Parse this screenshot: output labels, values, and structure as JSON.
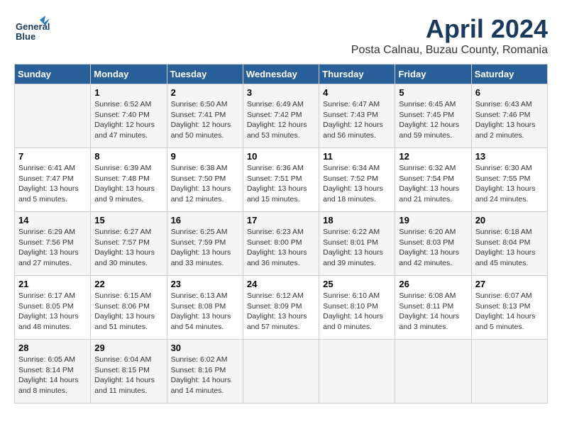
{
  "logo": {
    "line1": "General",
    "line2": "Blue"
  },
  "title": "April 2024",
  "subtitle": "Posta Calnau, Buzau County, Romania",
  "headers": [
    "Sunday",
    "Monday",
    "Tuesday",
    "Wednesday",
    "Thursday",
    "Friday",
    "Saturday"
  ],
  "weeks": [
    [
      {
        "day": "",
        "info": ""
      },
      {
        "day": "1",
        "info": "Sunrise: 6:52 AM\nSunset: 7:40 PM\nDaylight: 12 hours\nand 47 minutes."
      },
      {
        "day": "2",
        "info": "Sunrise: 6:50 AM\nSunset: 7:41 PM\nDaylight: 12 hours\nand 50 minutes."
      },
      {
        "day": "3",
        "info": "Sunrise: 6:49 AM\nSunset: 7:42 PM\nDaylight: 12 hours\nand 53 minutes."
      },
      {
        "day": "4",
        "info": "Sunrise: 6:47 AM\nSunset: 7:43 PM\nDaylight: 12 hours\nand 56 minutes."
      },
      {
        "day": "5",
        "info": "Sunrise: 6:45 AM\nSunset: 7:45 PM\nDaylight: 12 hours\nand 59 minutes."
      },
      {
        "day": "6",
        "info": "Sunrise: 6:43 AM\nSunset: 7:46 PM\nDaylight: 13 hours\nand 2 minutes."
      }
    ],
    [
      {
        "day": "7",
        "info": "Sunrise: 6:41 AM\nSunset: 7:47 PM\nDaylight: 13 hours\nand 5 minutes."
      },
      {
        "day": "8",
        "info": "Sunrise: 6:39 AM\nSunset: 7:48 PM\nDaylight: 13 hours\nand 9 minutes."
      },
      {
        "day": "9",
        "info": "Sunrise: 6:38 AM\nSunset: 7:50 PM\nDaylight: 13 hours\nand 12 minutes."
      },
      {
        "day": "10",
        "info": "Sunrise: 6:36 AM\nSunset: 7:51 PM\nDaylight: 13 hours\nand 15 minutes."
      },
      {
        "day": "11",
        "info": "Sunrise: 6:34 AM\nSunset: 7:52 PM\nDaylight: 13 hours\nand 18 minutes."
      },
      {
        "day": "12",
        "info": "Sunrise: 6:32 AM\nSunset: 7:54 PM\nDaylight: 13 hours\nand 21 minutes."
      },
      {
        "day": "13",
        "info": "Sunrise: 6:30 AM\nSunset: 7:55 PM\nDaylight: 13 hours\nand 24 minutes."
      }
    ],
    [
      {
        "day": "14",
        "info": "Sunrise: 6:29 AM\nSunset: 7:56 PM\nDaylight: 13 hours\nand 27 minutes."
      },
      {
        "day": "15",
        "info": "Sunrise: 6:27 AM\nSunset: 7:57 PM\nDaylight: 13 hours\nand 30 minutes."
      },
      {
        "day": "16",
        "info": "Sunrise: 6:25 AM\nSunset: 7:59 PM\nDaylight: 13 hours\nand 33 minutes."
      },
      {
        "day": "17",
        "info": "Sunrise: 6:23 AM\nSunset: 8:00 PM\nDaylight: 13 hours\nand 36 minutes."
      },
      {
        "day": "18",
        "info": "Sunrise: 6:22 AM\nSunset: 8:01 PM\nDaylight: 13 hours\nand 39 minutes."
      },
      {
        "day": "19",
        "info": "Sunrise: 6:20 AM\nSunset: 8:03 PM\nDaylight: 13 hours\nand 42 minutes."
      },
      {
        "day": "20",
        "info": "Sunrise: 6:18 AM\nSunset: 8:04 PM\nDaylight: 13 hours\nand 45 minutes."
      }
    ],
    [
      {
        "day": "21",
        "info": "Sunrise: 6:17 AM\nSunset: 8:05 PM\nDaylight: 13 hours\nand 48 minutes."
      },
      {
        "day": "22",
        "info": "Sunrise: 6:15 AM\nSunset: 8:06 PM\nDaylight: 13 hours\nand 51 minutes."
      },
      {
        "day": "23",
        "info": "Sunrise: 6:13 AM\nSunset: 8:08 PM\nDaylight: 13 hours\nand 54 minutes."
      },
      {
        "day": "24",
        "info": "Sunrise: 6:12 AM\nSunset: 8:09 PM\nDaylight: 13 hours\nand 57 minutes."
      },
      {
        "day": "25",
        "info": "Sunrise: 6:10 AM\nSunset: 8:10 PM\nDaylight: 14 hours\nand 0 minutes."
      },
      {
        "day": "26",
        "info": "Sunrise: 6:08 AM\nSunset: 8:11 PM\nDaylight: 14 hours\nand 3 minutes."
      },
      {
        "day": "27",
        "info": "Sunrise: 6:07 AM\nSunset: 8:13 PM\nDaylight: 14 hours\nand 5 minutes."
      }
    ],
    [
      {
        "day": "28",
        "info": "Sunrise: 6:05 AM\nSunset: 8:14 PM\nDaylight: 14 hours\nand 8 minutes."
      },
      {
        "day": "29",
        "info": "Sunrise: 6:04 AM\nSunset: 8:15 PM\nDaylight: 14 hours\nand 11 minutes."
      },
      {
        "day": "30",
        "info": "Sunrise: 6:02 AM\nSunset: 8:16 PM\nDaylight: 14 hours\nand 14 minutes."
      },
      {
        "day": "",
        "info": ""
      },
      {
        "day": "",
        "info": ""
      },
      {
        "day": "",
        "info": ""
      },
      {
        "day": "",
        "info": ""
      }
    ]
  ]
}
